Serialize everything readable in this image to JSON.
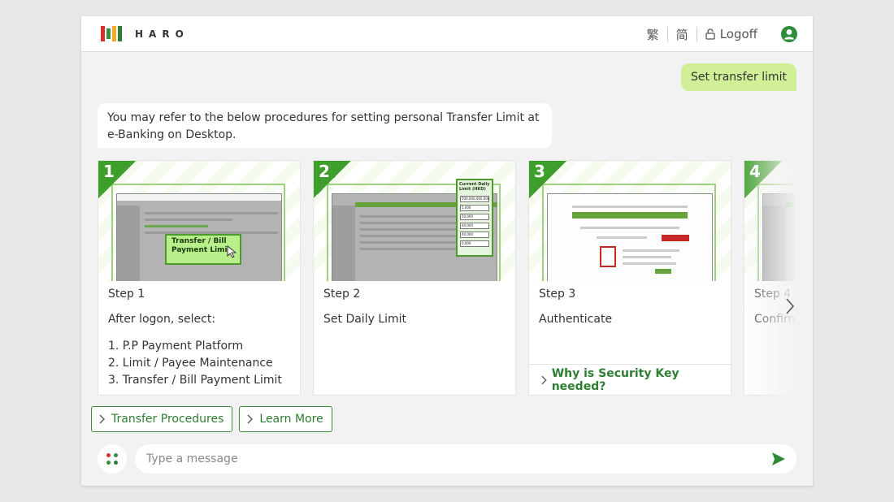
{
  "header": {
    "brand": "HARO",
    "lang_traditional": "繁",
    "lang_simplified": "简",
    "logoff_label": "Logoff",
    "logo_colors": [
      "#d32f2f",
      "#388e3c",
      "#f9a825",
      "#2e7d32"
    ]
  },
  "chat": {
    "user_message": "Set transfer limit",
    "bot_message": "You may refer to the below procedures for setting personal Transfer Limit at e-Banking on Desktop."
  },
  "cards": [
    {
      "number": "1",
      "title": "Step 1",
      "description": "After logon, select:",
      "list": [
        "1. P.P Payment Platform",
        "2. Limit / Payee Maintenance",
        "3. Transfer / Bill Payment Limit"
      ],
      "callout": "Transfer / Bill Payment Limit"
    },
    {
      "number": "2",
      "title": "Step 2",
      "description": "Set Daily Limit",
      "callout_title": "Current Daily Limit (HKD)",
      "limits": [
        "500,000,000,000",
        "5,000",
        "50,000",
        "40,000",
        "40,000",
        "0,000"
      ]
    },
    {
      "number": "3",
      "title": "Step 3",
      "description": "Authenticate",
      "link": "Why is Security Key needed?"
    },
    {
      "number": "4",
      "title": "Step 4",
      "description": "Confirm"
    }
  ],
  "quick_replies": [
    "Transfer Procedures",
    "Learn More"
  ],
  "composer": {
    "placeholder": "Type a message"
  },
  "colors": {
    "accent": "#2e7d32",
    "user_bubble": "#d1ef96"
  }
}
